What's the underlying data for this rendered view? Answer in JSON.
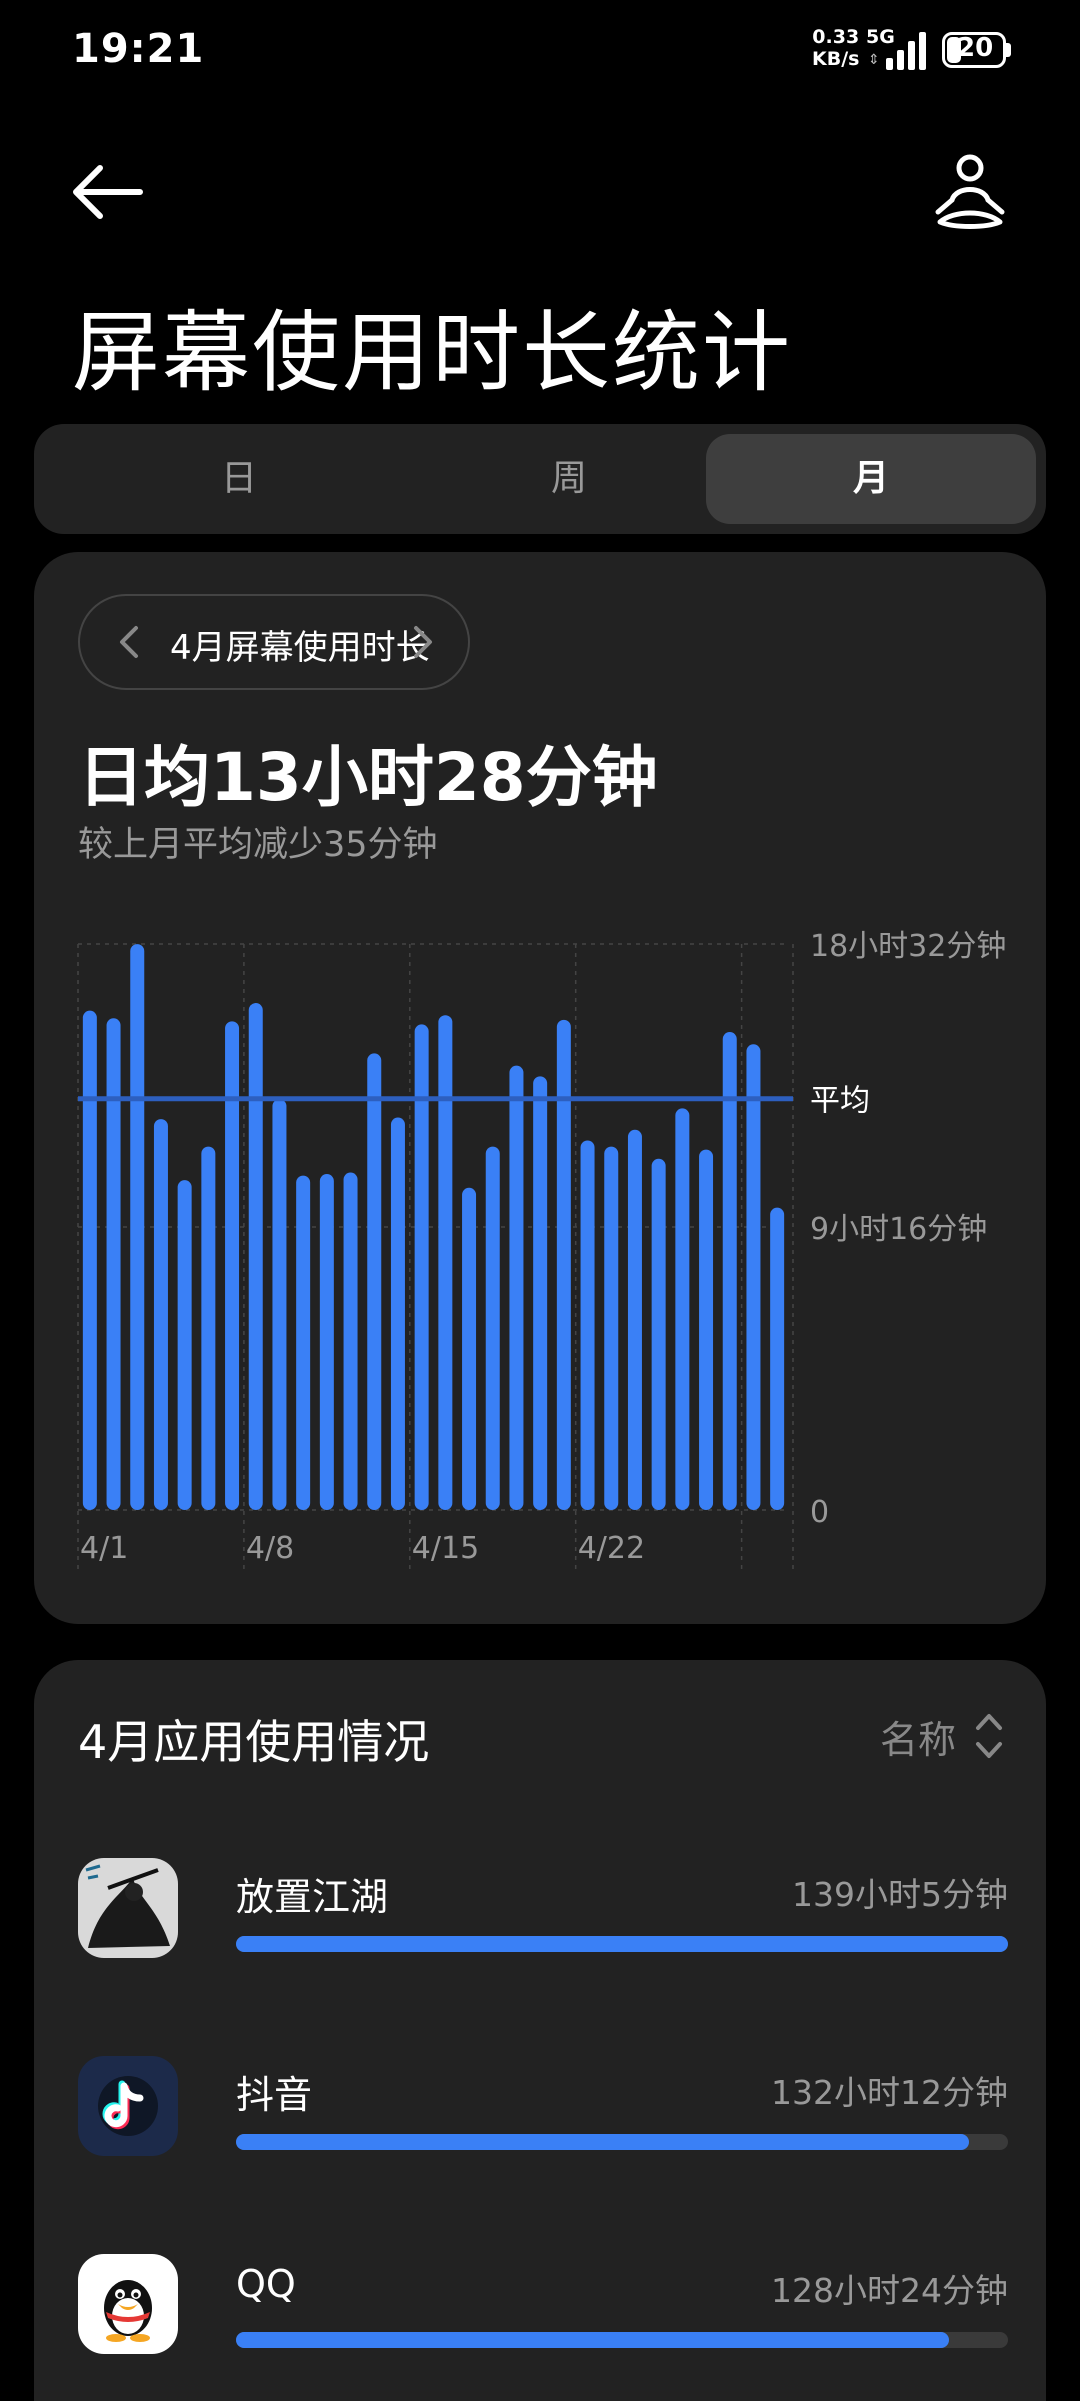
{
  "status_bar": {
    "time": "19:21",
    "net_speed_value": "0.33",
    "net_speed_unit": "KB/s",
    "network": "5G",
    "battery": "20"
  },
  "header": {
    "back_icon": "arrow-left-icon",
    "profile_icon": "meditation-person-icon",
    "title": "屏幕使用时长统计"
  },
  "tabs": [
    {
      "label": "日",
      "selected": false
    },
    {
      "label": "周",
      "selected": false
    },
    {
      "label": "月",
      "selected": true
    }
  ],
  "summary": {
    "period_label": "4月屏幕使用时长",
    "daily_average": "日均13小时28分钟",
    "comparison": "较上月平均减少35分钟"
  },
  "chart_data": {
    "type": "bar",
    "unit": "hours",
    "categories": [
      "4/1",
      "4/2",
      "4/3",
      "4/4",
      "4/5",
      "4/6",
      "4/7",
      "4/8",
      "4/9",
      "4/10",
      "4/11",
      "4/12",
      "4/13",
      "4/14",
      "4/15",
      "4/16",
      "4/17",
      "4/18",
      "4/19",
      "4/20",
      "4/21",
      "4/22",
      "4/23",
      "4/24",
      "4/25",
      "4/26",
      "4/27",
      "4/28",
      "4/29",
      "4/30"
    ],
    "values": [
      16.35,
      16.1,
      18.53,
      12.8,
      10.8,
      11.9,
      16.0,
      16.6,
      13.45,
      10.95,
      11.0,
      11.05,
      14.95,
      12.85,
      15.9,
      16.2,
      10.55,
      11.9,
      14.55,
      14.2,
      16.05,
      12.1,
      11.9,
      12.45,
      11.5,
      13.15,
      11.8,
      15.65,
      15.25,
      9.9
    ],
    "x_tick_labels": [
      "4/1",
      "4/8",
      "4/15",
      "4/22"
    ],
    "y_ticks": [
      {
        "value": 18.533,
        "label": "18小时32分钟"
      },
      {
        "value": 9.267,
        "label": "9小时16分钟"
      },
      {
        "value": 0,
        "label": "0"
      }
    ],
    "average": {
      "value": 13.467,
      "label": "平均"
    },
    "ylim": [
      0,
      18.533
    ],
    "bar_color": "#3a80f6",
    "average_line_color": "#2d5fbf"
  },
  "apps_section": {
    "title": "4月应用使用情况",
    "sort_label": "名称",
    "sort_icon": "sort-updown-icon",
    "apps": [
      {
        "name": "放置江湖",
        "time": "139小时5分钟",
        "fraction": 1.0,
        "icon": "fangzhi-jianghu-app-icon"
      },
      {
        "name": "抖音",
        "time": "132小时12分钟",
        "fraction": 0.95,
        "icon": "douyin-app-icon"
      },
      {
        "name": "QQ",
        "time": "128小时24分钟",
        "fraction": 0.923,
        "icon": "qq-app-icon"
      }
    ]
  },
  "colors": {
    "accent": "#3a80f6",
    "card_bg": "#222222",
    "background": "#000000"
  }
}
